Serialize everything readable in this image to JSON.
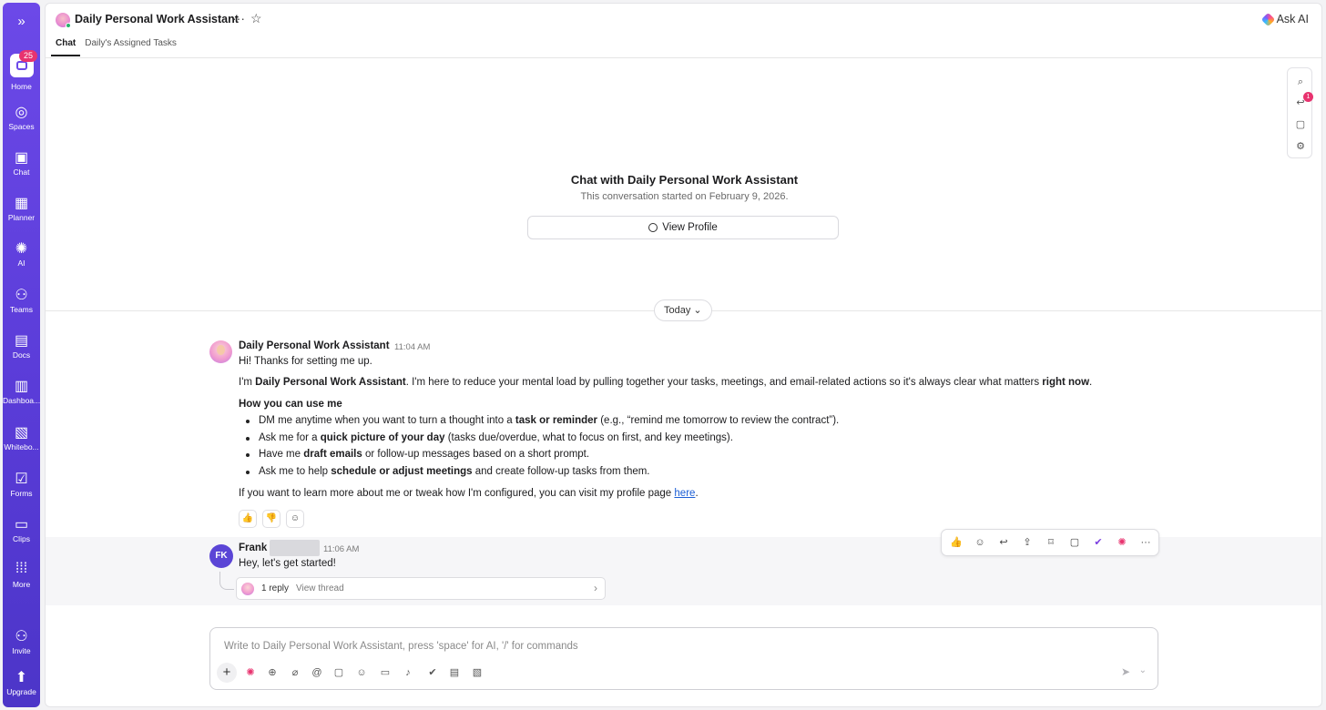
{
  "rail": {
    "expand_icon": "»",
    "home": {
      "label": "Home",
      "badge": "25"
    },
    "items": [
      {
        "label": "Spaces",
        "icon": "planet-icon",
        "glyph": "◎"
      },
      {
        "label": "Chat",
        "icon": "chat-icon",
        "glyph": "▣"
      },
      {
        "label": "Planner",
        "icon": "calendar-icon",
        "glyph": "▦"
      },
      {
        "label": "AI",
        "icon": "ai-icon",
        "glyph": "✺"
      },
      {
        "label": "Teams",
        "icon": "teams-icon",
        "glyph": "⚇"
      },
      {
        "label": "Docs",
        "icon": "docs-icon",
        "glyph": "▤"
      },
      {
        "label": "Dashboa...",
        "icon": "dashboard-icon",
        "glyph": "▥"
      },
      {
        "label": "Whitebo...",
        "icon": "whiteboard-icon",
        "glyph": "▧"
      },
      {
        "label": "Forms",
        "icon": "forms-icon",
        "glyph": "☑"
      },
      {
        "label": "Clips",
        "icon": "video-icon",
        "glyph": "▭"
      },
      {
        "label": "More",
        "icon": "grid-icon",
        "glyph": "⁞⁞⁞"
      }
    ],
    "invite": {
      "label": "Invite",
      "glyph": "⚇"
    },
    "upgrade": {
      "label": "Upgrade",
      "glyph": "⬆"
    }
  },
  "header": {
    "title": "Daily Personal Work Assistant",
    "more_glyph": "···",
    "star_glyph": "☆",
    "ask_ai": "Ask AI",
    "tabs": [
      {
        "label": "Chat",
        "active": true
      },
      {
        "label": "Daily's Assigned Tasks",
        "active": false
      }
    ]
  },
  "side_tools": {
    "search_glyph": "⌕",
    "reply_glyph": "↩",
    "reply_badge": "1",
    "chat_glyph": "▢",
    "settings_glyph": "⚙"
  },
  "intro": {
    "title": "Chat with Daily Personal Work Assistant",
    "subtitle": "This conversation started on February 9, 2026.",
    "view_profile": "View Profile"
  },
  "divider": {
    "label": "Today",
    "chevron": "⌄"
  },
  "message1": {
    "author": "Daily Personal Work Assistant",
    "time": "11:04 AM",
    "greeting": "Hi! Thanks for setting me up.",
    "intro_parts": {
      "p1": "I'm ",
      "b1": "Daily Personal Work Assistant",
      "p2": ". I'm here to reduce your mental load by pulling together your tasks, meetings, and email-related actions so it's always clear what matters ",
      "b2": "right now",
      "p3": "."
    },
    "how_heading": "How you can use me",
    "bullets": [
      {
        "pre": "DM me anytime when you want to turn a thought into a ",
        "bold": "task or reminder",
        "post": " (e.g., “remind me tomorrow to review the contract”)."
      },
      {
        "pre": "Ask me for a ",
        "bold": "quick picture of your day",
        "post": " (tasks due/overdue, what to focus on first, and key meetings)."
      },
      {
        "pre": "Have me ",
        "bold": "draft emails",
        "post": " or follow-up messages based on a short prompt."
      },
      {
        "pre": "Ask me to help ",
        "bold": "schedule or adjust meetings",
        "post": " and create follow-up tasks from them."
      }
    ],
    "outro": "If you want to learn more about me or tweak how I'm configured, you can visit my profile page ",
    "outro_link": "here",
    "outro_end": ".",
    "reactions": [
      "👍",
      "👎",
      "☺"
    ]
  },
  "message2": {
    "initials": "FK",
    "author": "Frank",
    "time": "11:06 AM",
    "text": "Hey, let's get started!",
    "thread": {
      "replies": "1 reply",
      "view": "View thread",
      "chevron": "›"
    }
  },
  "hover_toolbar": {
    "icons": [
      {
        "name": "thumbs-up-icon",
        "glyph": "👍"
      },
      {
        "name": "emoji-add-icon",
        "glyph": "☺"
      },
      {
        "name": "reply-icon",
        "glyph": "↩"
      },
      {
        "name": "share-icon",
        "glyph": "⇪"
      },
      {
        "name": "bookmark-icon",
        "glyph": "⌑"
      },
      {
        "name": "comment-icon",
        "glyph": "▢"
      },
      {
        "name": "task-check-icon",
        "glyph": "✔"
      },
      {
        "name": "ai-icon",
        "glyph": "✺"
      },
      {
        "name": "more-icon",
        "glyph": "···"
      }
    ]
  },
  "composer": {
    "placeholder": "Write to Daily Personal Work Assistant, press 'space' for AI, '/' for commands",
    "plus": "+",
    "tools": [
      {
        "name": "ai-icon",
        "glyph": "✺"
      },
      {
        "name": "mention-plus-icon",
        "glyph": "⊕"
      },
      {
        "name": "attachment-icon",
        "glyph": "⌀"
      },
      {
        "name": "at-icon",
        "glyph": "@"
      },
      {
        "name": "comment-icon",
        "glyph": "▢"
      },
      {
        "name": "emoji-icon",
        "glyph": "☺"
      },
      {
        "name": "video-icon",
        "glyph": "▭"
      },
      {
        "name": "microphone-icon",
        "glyph": "♪"
      },
      {
        "name": "task-check-icon",
        "glyph": "✔"
      },
      {
        "name": "doc-plus-icon",
        "glyph": "▤"
      },
      {
        "name": "screenshot-icon",
        "glyph": "▧"
      }
    ],
    "send_glyph": "➤",
    "caret_glyph": "⌄"
  },
  "colors": {
    "rail": "#6c49e8",
    "badge": "#e8336f",
    "link": "#1d5fd6",
    "avatar_fk": "#5b45d6"
  }
}
